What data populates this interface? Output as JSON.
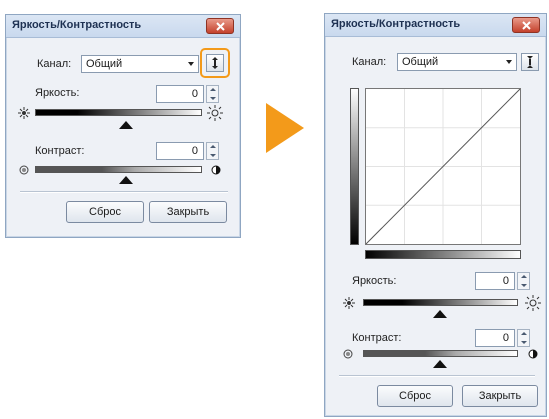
{
  "dialog_small": {
    "title": "Яркость/Контрастность",
    "channel_label": "Канал:",
    "channel_value": "Общий",
    "brightness_label": "Яркость:",
    "brightness_value": "0",
    "contrast_label": "Контраст:",
    "contrast_value": "0",
    "reset_button": "Сброс",
    "close_button": "Закрыть"
  },
  "dialog_large": {
    "title": "Яркость/Контрастность",
    "channel_label": "Канал:",
    "channel_value": "Общий",
    "brightness_label": "Яркость:",
    "brightness_value": "0",
    "contrast_label": "Контраст:",
    "contrast_value": "0",
    "reset_button": "Сброс",
    "close_button": "Закрыть"
  },
  "colors": {
    "highlight": "#f39a1a",
    "arrow": "#f39a1a",
    "close_button": "#c4412c"
  }
}
